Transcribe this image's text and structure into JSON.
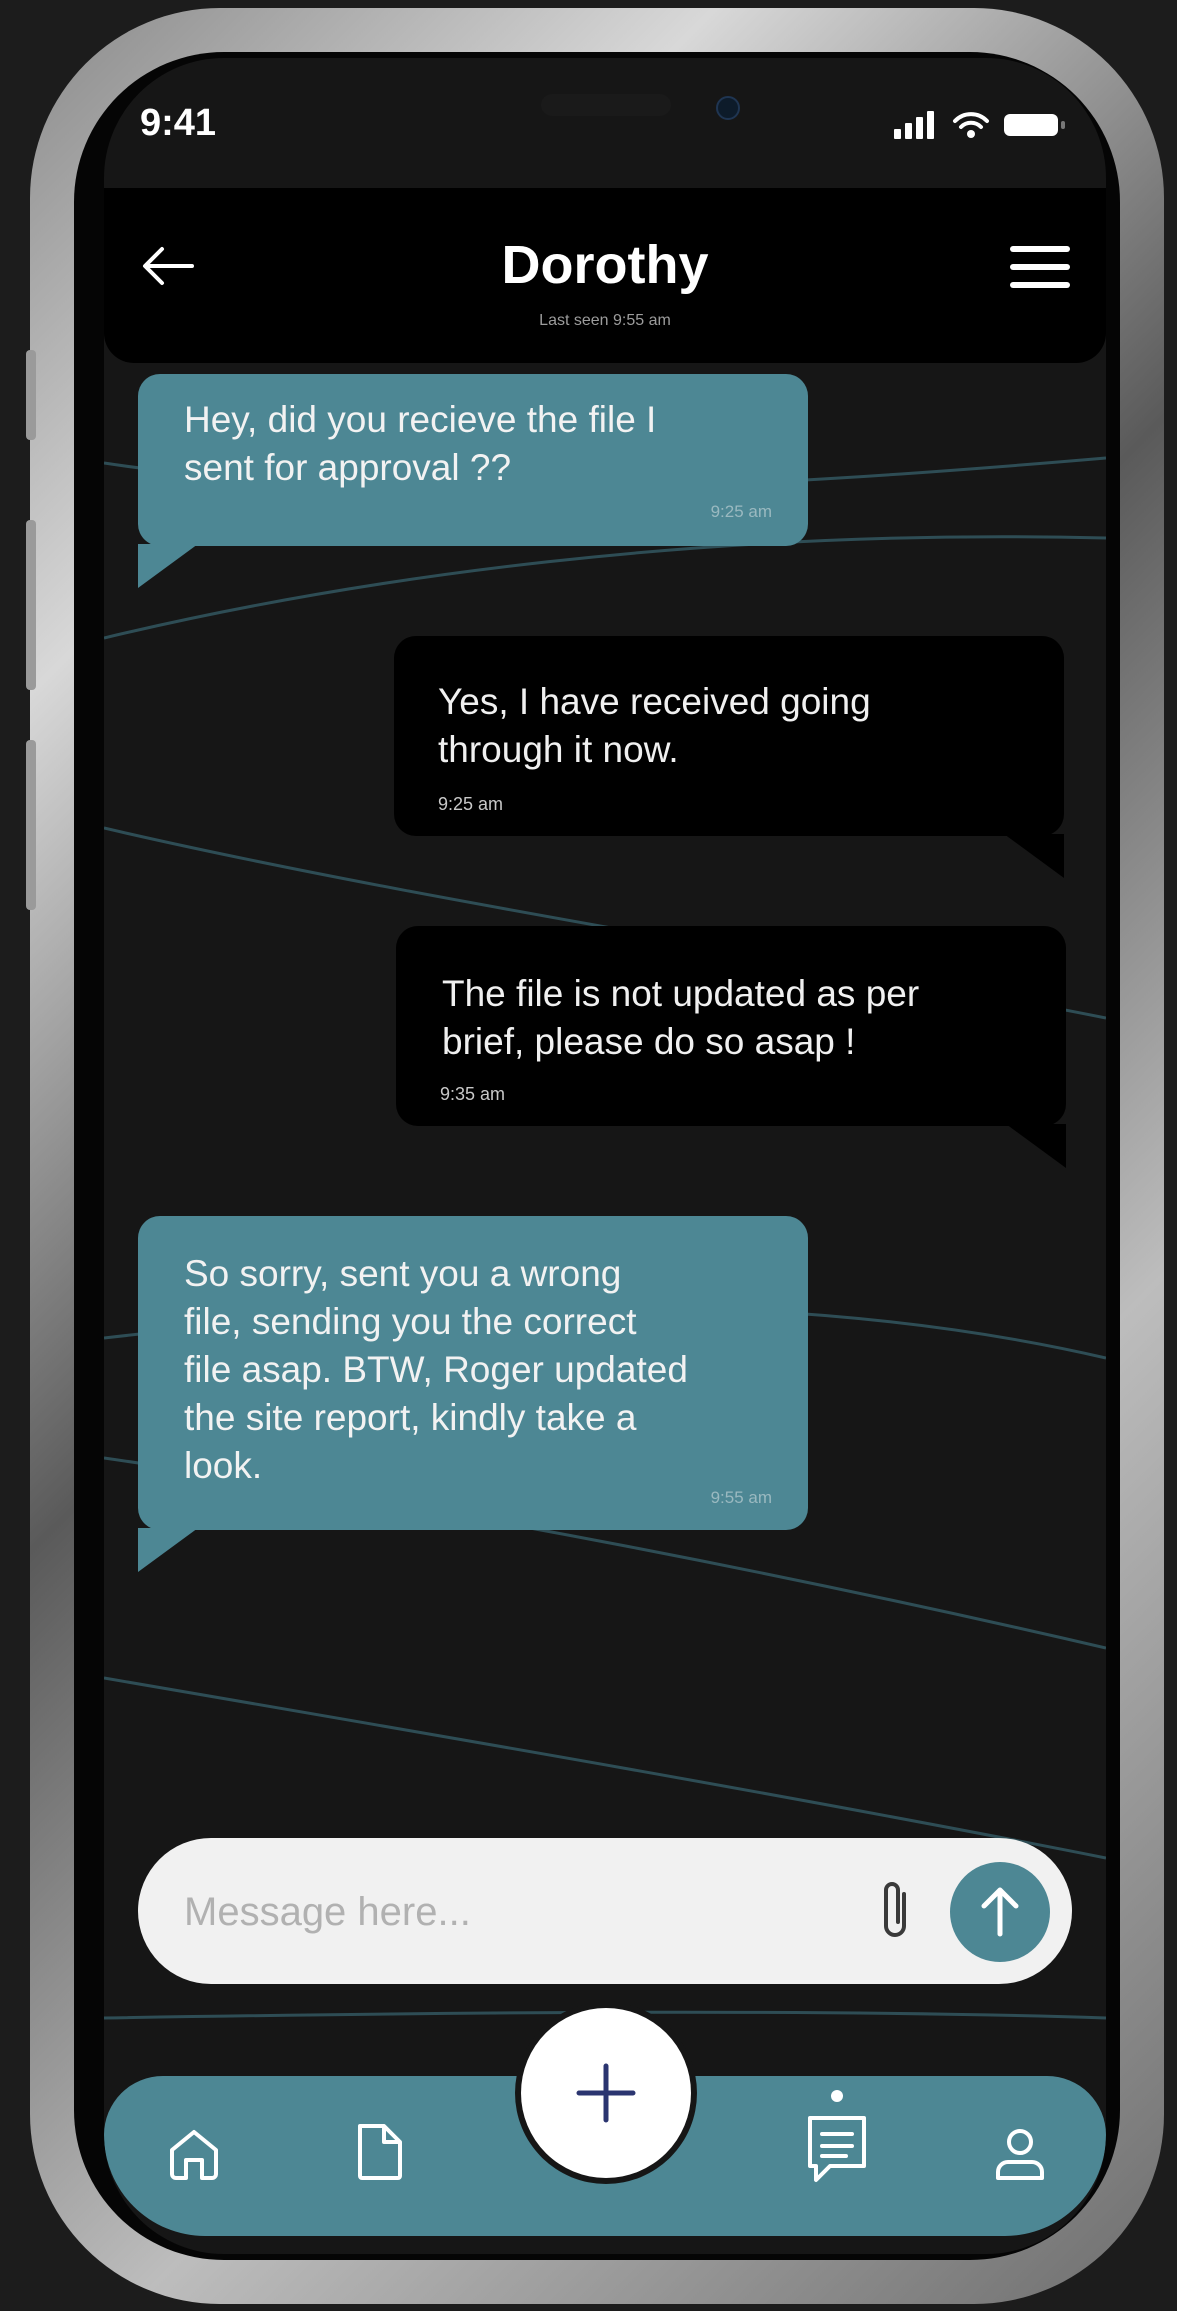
{
  "status_bar": {
    "time": "9:41"
  },
  "header": {
    "contact_name": "Dorothy",
    "last_seen": "Last seen 9:55 am"
  },
  "messages": [
    {
      "direction": "incoming",
      "text": "Hey, did you recieve the file I\nsent for approval ??",
      "time": "9:25 am"
    },
    {
      "direction": "outgoing",
      "text": "Yes, I have received going\nthrough it now.",
      "time": "9:25 am"
    },
    {
      "direction": "outgoing",
      "text": "The file is not updated as per\nbrief, please do so asap !",
      "time": "9:35 am"
    },
    {
      "direction": "incoming",
      "text": "So sorry, sent you a wrong\nfile, sending you the correct\nfile asap. BTW, Roger updated\nthe site report, kindly take a\nlook.",
      "time": "9:55 am"
    }
  ],
  "composer": {
    "placeholder": "Message here..."
  },
  "icons": {
    "back": "back-arrow-icon",
    "menu": "hamburger-menu-icon",
    "attach": "paperclip-icon",
    "send": "arrow-up-icon",
    "fab": "plus-icon",
    "tabs": [
      "home-icon",
      "document-icon",
      "chat-icon",
      "profile-icon"
    ]
  },
  "tabbar": {
    "active_tab": "chat"
  },
  "colors": {
    "accent": "#4d8794",
    "incoming_bubble": "#4d8794",
    "outgoing_bubble": "#000000",
    "background": "#161616"
  }
}
